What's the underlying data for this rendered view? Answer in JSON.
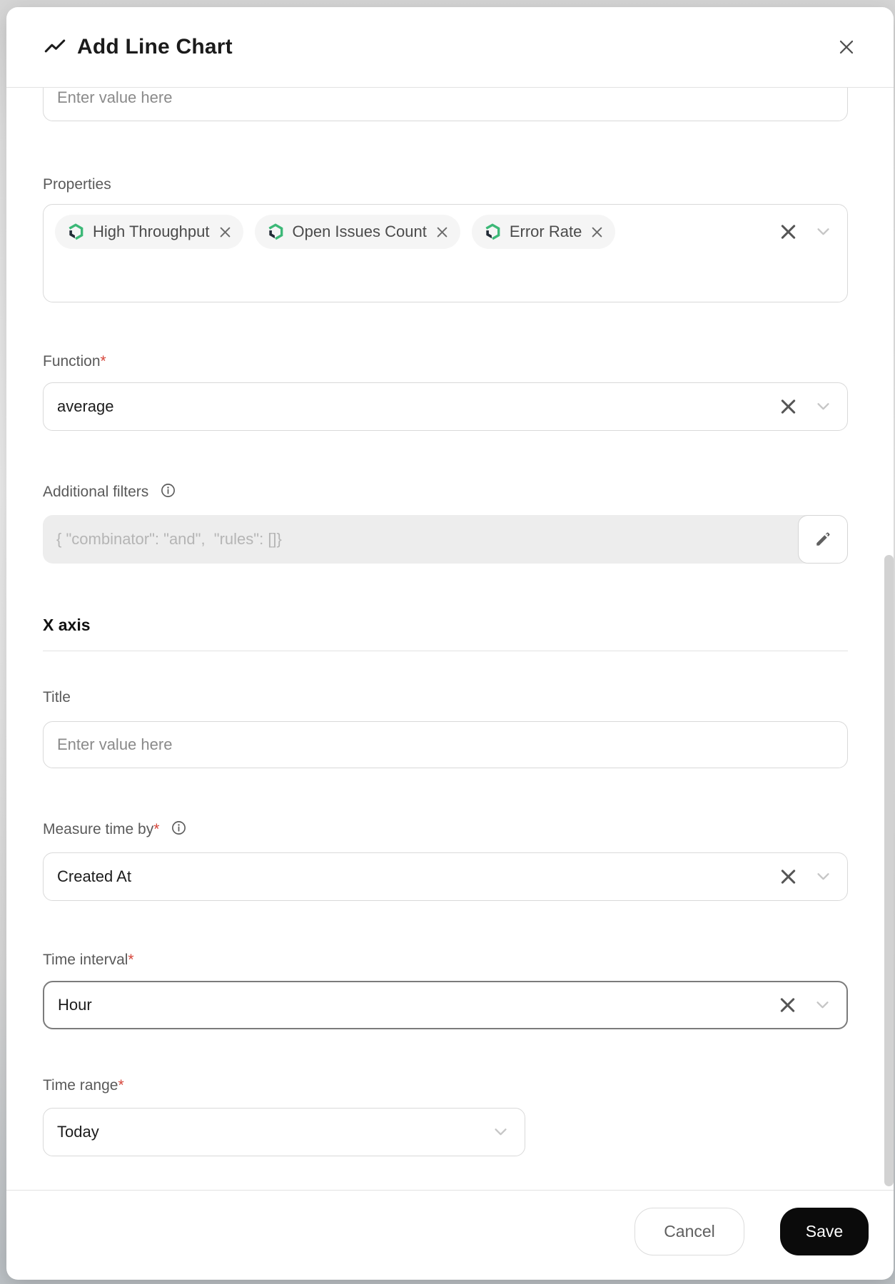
{
  "modal": {
    "title": "Add Line Chart"
  },
  "required_mark": "*",
  "fields": {
    "top_input": {
      "placeholder": "Enter value here"
    },
    "properties": {
      "label": "Properties",
      "tags": [
        "High Throughput",
        "Open Issues Count",
        "Error Rate"
      ]
    },
    "function": {
      "label": "Function",
      "value": "average"
    },
    "additional_filters": {
      "label": "Additional filters",
      "value": "{ \"combinator\": \"and\",  \"rules\": []}"
    },
    "x_axis_section": {
      "label": "X axis"
    },
    "title_field": {
      "label": "Title",
      "placeholder": "Enter value here"
    },
    "measure_time_by": {
      "label": "Measure time by",
      "value": "Created At"
    },
    "time_interval": {
      "label": "Time interval",
      "value": "Hour"
    },
    "time_range": {
      "label": "Time range",
      "value": "Today"
    }
  },
  "footer": {
    "cancel_label": "Cancel",
    "save_label": "Save"
  },
  "colors": {
    "accent_green": "#3cb877",
    "icon_dark": "#222b36",
    "save_bg": "#0b0b0b",
    "required_red": "#d6453a",
    "border": "#d9d9d9",
    "focused_border": "#7b7b7b"
  }
}
